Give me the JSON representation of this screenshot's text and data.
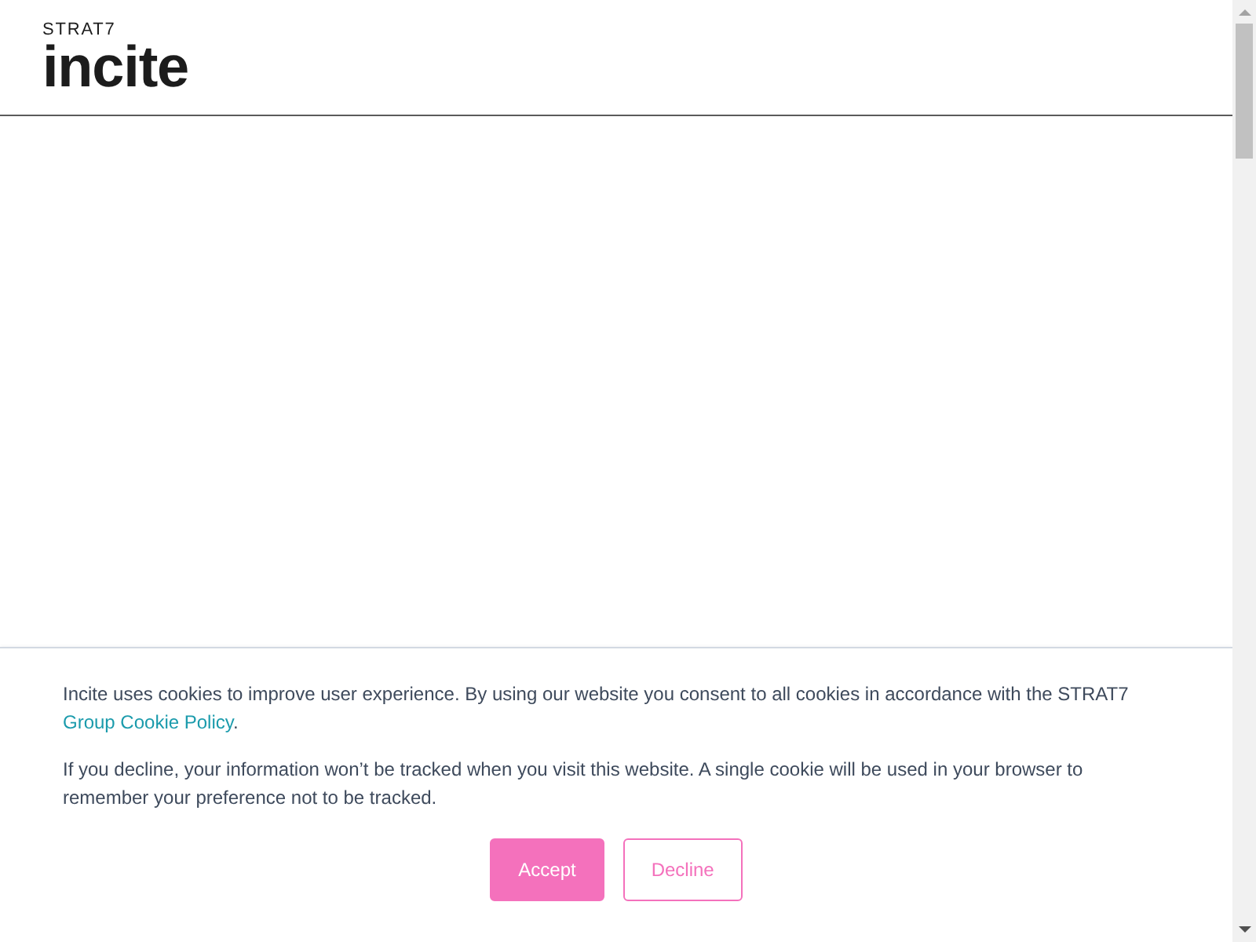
{
  "header": {
    "logo": {
      "tagline": "STRAT7",
      "wordmark": "incite"
    }
  },
  "cookie_banner": {
    "paragraphs": [
      {
        "text": "Incite uses cookies to improve user experience. By using our website you consent to all cookies in accordance with the STRAT7",
        "link": "Group Cookie Policy",
        "after": "."
      },
      {
        "text": "If you decline, your information won’t be tracked when you visit this website. A single cookie will be used in your browser to remember your preference not to be tracked."
      }
    ],
    "buttons": [
      {
        "label": "Accept",
        "kind": "primary"
      },
      {
        "label": "Decline",
        "kind": "secondary"
      }
    ]
  }
}
